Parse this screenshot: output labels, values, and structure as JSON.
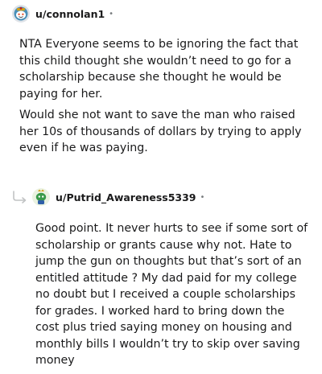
{
  "comments": [
    {
      "username": "u/connolan1",
      "separator": "•",
      "paragraphs": [
        "NTA Everyone seems to be ignoring the fact that this child thought she wouldn’t need to go for a scholarship because she thought he would be paying for her.",
        "Would she not want to save the man who raised her 10s of thousands of dollars by trying to apply even if he was paying."
      ],
      "avatar_icon": "snoo-avatar-icon"
    },
    {
      "username": "u/Putrid_Awareness5339",
      "separator": "•",
      "paragraphs": [
        "Good point. It never hurts to see if some sort of scholarship or grants cause why not. Hate to jump the gun on thoughts but that’s sort of an entitled attitude ? My dad paid for my college no doubt but I received a couple scholarships for grades. I worked hard to bring down the cost plus tried saying money on housing and monthly bills I wouldn’t try to skip over saving money"
      ],
      "avatar_icon": "snoo-avatar-icon",
      "is_reply": true
    }
  ],
  "colors": {
    "text": "#1a1a1b",
    "meta": "#787c7e",
    "reply_arrow": "#c1c3c4"
  }
}
